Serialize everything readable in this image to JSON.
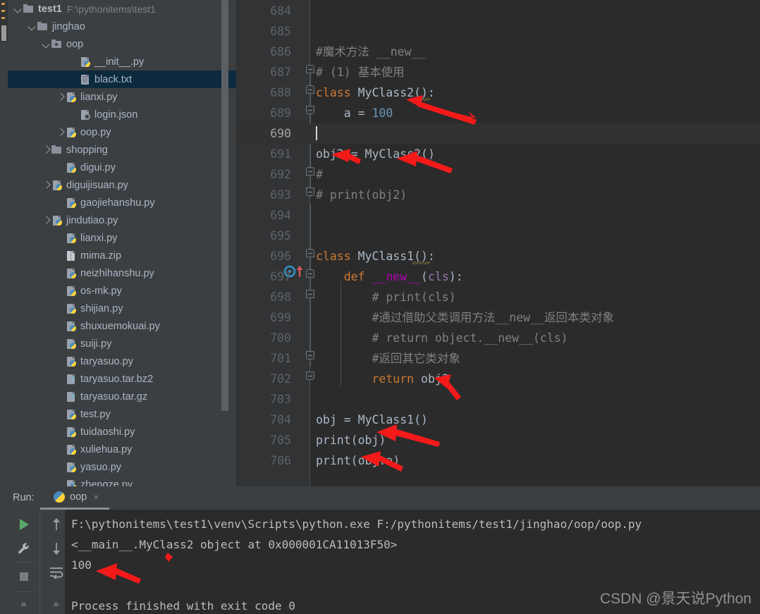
{
  "app": {
    "theme_bg": "#3c3f41",
    "editor_bg": "#2b2b2b",
    "accent": "#4a88c7",
    "selection_bg": "#0d293e",
    "watermark": "CSDN @景天说Python"
  },
  "project_tree": {
    "items": [
      {
        "indent": 0,
        "twisty": "down",
        "icon": "folder-icon",
        "label": "test1",
        "path": "F:\\pythonitems\\test1",
        "bold": true,
        "selected": false
      },
      {
        "indent": 1,
        "twisty": "down",
        "icon": "folder-icon",
        "label": "jinghao",
        "path": "",
        "bold": false,
        "selected": false
      },
      {
        "indent": 2,
        "twisty": "down",
        "icon": "folder-src-icon",
        "label": "oop",
        "path": "",
        "bold": false,
        "selected": false
      },
      {
        "indent": 4,
        "twisty": "none",
        "icon": "python-file-icon",
        "label": "__init__.py",
        "path": "",
        "bold": false,
        "selected": false
      },
      {
        "indent": 4,
        "twisty": "none",
        "icon": "text-file-icon",
        "label": "black.txt",
        "path": "",
        "bold": false,
        "selected": true
      },
      {
        "indent": 3,
        "twisty": "right",
        "icon": "python-file-icon",
        "label": "lianxi.py",
        "path": "",
        "bold": false,
        "selected": false
      },
      {
        "indent": 4,
        "twisty": "none",
        "icon": "json-file-icon",
        "label": "login.json",
        "path": "",
        "bold": false,
        "selected": false
      },
      {
        "indent": 3,
        "twisty": "right",
        "icon": "python-file-icon",
        "label": "oop.py",
        "path": "",
        "bold": false,
        "selected": false
      },
      {
        "indent": 2,
        "twisty": "right",
        "icon": "folder-icon",
        "label": "shopping",
        "path": "",
        "bold": false,
        "selected": false
      },
      {
        "indent": 3,
        "twisty": "none",
        "icon": "python-file-icon",
        "label": "digui.py",
        "path": "",
        "bold": false,
        "selected": false
      },
      {
        "indent": 2,
        "twisty": "right",
        "icon": "python-file-icon",
        "label": "diguijisuan.py",
        "path": "",
        "bold": false,
        "selected": false
      },
      {
        "indent": 3,
        "twisty": "none",
        "icon": "python-file-icon",
        "label": "gaojiehanshu.py",
        "path": "",
        "bold": false,
        "selected": false
      },
      {
        "indent": 2,
        "twisty": "right",
        "icon": "python-file-icon",
        "label": "jindutiao.py",
        "path": "",
        "bold": false,
        "selected": false
      },
      {
        "indent": 3,
        "twisty": "none",
        "icon": "python-file-icon",
        "label": "lianxi.py",
        "path": "",
        "bold": false,
        "selected": false
      },
      {
        "indent": 3,
        "twisty": "none",
        "icon": "zip-file-icon",
        "label": "mima.zip",
        "path": "",
        "bold": false,
        "selected": false
      },
      {
        "indent": 3,
        "twisty": "none",
        "icon": "python-file-icon",
        "label": "neizhihanshu.py",
        "path": "",
        "bold": false,
        "selected": false
      },
      {
        "indent": 3,
        "twisty": "none",
        "icon": "python-file-icon",
        "label": "os-mk.py",
        "path": "",
        "bold": false,
        "selected": false
      },
      {
        "indent": 3,
        "twisty": "none",
        "icon": "python-file-icon",
        "label": "shijian.py",
        "path": "",
        "bold": false,
        "selected": false
      },
      {
        "indent": 3,
        "twisty": "none",
        "icon": "python-file-icon",
        "label": "shuxuemokuai.py",
        "path": "",
        "bold": false,
        "selected": false
      },
      {
        "indent": 3,
        "twisty": "none",
        "icon": "python-file-icon",
        "label": "suiji.py",
        "path": "",
        "bold": false,
        "selected": false
      },
      {
        "indent": 3,
        "twisty": "none",
        "icon": "python-file-icon",
        "label": "taryasuo.py",
        "path": "",
        "bold": false,
        "selected": false
      },
      {
        "indent": 3,
        "twisty": "none",
        "icon": "unknown-file-icon",
        "label": "taryasuo.tar.bz2",
        "path": "",
        "bold": false,
        "selected": false
      },
      {
        "indent": 3,
        "twisty": "none",
        "icon": "unknown-file-icon",
        "label": "taryasuo.tar.gz",
        "path": "",
        "bold": false,
        "selected": false
      },
      {
        "indent": 3,
        "twisty": "none",
        "icon": "python-file-icon",
        "label": "test.py",
        "path": "",
        "bold": false,
        "selected": false
      },
      {
        "indent": 3,
        "twisty": "none",
        "icon": "python-file-icon",
        "label": "tuidaoshi.py",
        "path": "",
        "bold": false,
        "selected": false
      },
      {
        "indent": 3,
        "twisty": "none",
        "icon": "python-file-icon",
        "label": "xuliehua.py",
        "path": "",
        "bold": false,
        "selected": false
      },
      {
        "indent": 3,
        "twisty": "none",
        "icon": "python-file-icon",
        "label": "yasuo.py",
        "path": "",
        "bold": false,
        "selected": false
      },
      {
        "indent": 3,
        "twisty": "none",
        "icon": "python-file-icon",
        "label": "zhengze.py",
        "path": "",
        "bold": false,
        "selected": false
      }
    ]
  },
  "editor": {
    "first_line_number": 684,
    "current_line_number": 690,
    "lines": [
      {
        "n": 684,
        "tokens": []
      },
      {
        "n": 685,
        "tokens": []
      },
      {
        "n": 686,
        "tokens": [
          {
            "t": "#魔术方法 __new__",
            "c": "cmt"
          }
        ]
      },
      {
        "n": 687,
        "tokens": [
          {
            "t": "# (1) 基本使用",
            "c": "cmt"
          }
        ]
      },
      {
        "n": 688,
        "tokens": [
          {
            "t": "class ",
            "c": "kw"
          },
          {
            "t": "MyClass2",
            "c": "cls"
          },
          {
            "t": "():",
            "c": "var"
          }
        ]
      },
      {
        "n": 689,
        "tokens": [
          {
            "t": "    a = ",
            "c": "var"
          },
          {
            "t": "100",
            "c": "num"
          }
        ]
      },
      {
        "n": 690,
        "tokens": []
      },
      {
        "n": 691,
        "tokens": [
          {
            "t": "obj2 = ",
            "c": "var"
          },
          {
            "t": "MyClass2",
            "c": "cls"
          },
          {
            "t": "()",
            "c": "var"
          }
        ]
      },
      {
        "n": 692,
        "tokens": [
          {
            "t": "#",
            "c": "cmt"
          }
        ]
      },
      {
        "n": 693,
        "tokens": [
          {
            "t": "# print(obj2)",
            "c": "cmt"
          }
        ]
      },
      {
        "n": 694,
        "tokens": []
      },
      {
        "n": 695,
        "tokens": []
      },
      {
        "n": 696,
        "tokens": [
          {
            "t": "class ",
            "c": "kw"
          },
          {
            "t": "MyClass1",
            "c": "cls"
          },
          {
            "t": "():",
            "c": "var"
          }
        ]
      },
      {
        "n": 697,
        "tokens": [
          {
            "t": "    ",
            "c": "var"
          },
          {
            "t": "def ",
            "c": "kw"
          },
          {
            "t": "__new__",
            "c": "magic"
          },
          {
            "t": "(",
            "c": "var"
          },
          {
            "t": "cls",
            "c": "param"
          },
          {
            "t": "):",
            "c": "var"
          }
        ]
      },
      {
        "n": 698,
        "tokens": [
          {
            "t": "        # print(cls)",
            "c": "cmt"
          }
        ]
      },
      {
        "n": 699,
        "tokens": [
          {
            "t": "        #通过借助父类调用方法__new__返回本类对象",
            "c": "cmt"
          }
        ]
      },
      {
        "n": 700,
        "tokens": [
          {
            "t": "        # return object.__new__(cls)",
            "c": "cmt"
          }
        ]
      },
      {
        "n": 701,
        "tokens": [
          {
            "t": "        #返回其它类对象",
            "c": "cmt"
          }
        ]
      },
      {
        "n": 702,
        "tokens": [
          {
            "t": "        ",
            "c": "var"
          },
          {
            "t": "return ",
            "c": "kw"
          },
          {
            "t": "obj2",
            "c": "var"
          }
        ]
      },
      {
        "n": 703,
        "tokens": []
      },
      {
        "n": 704,
        "tokens": [
          {
            "t": "obj = ",
            "c": "var"
          },
          {
            "t": "MyClass1",
            "c": "cls"
          },
          {
            "t": "()",
            "c": "var"
          }
        ]
      },
      {
        "n": 705,
        "tokens": [
          {
            "t": "print",
            "c": "fn"
          },
          {
            "t": "(obj)",
            "c": "var"
          }
        ]
      },
      {
        "n": 706,
        "tokens": [
          {
            "t": "print",
            "c": "fn"
          },
          {
            "t": "(obj.a)",
            "c": "var"
          }
        ]
      }
    ]
  },
  "run_panel": {
    "label": "Run:",
    "tab_name": "oop",
    "tab_close": "×",
    "toolbar": {
      "rerun": "run-icon",
      "settings": "wrench-icon",
      "stop": "stop-icon",
      "expand_left": "»",
      "up": "up-arrow-icon",
      "down": "down-arrow-icon",
      "soft_wrap": "soft-wrap-icon",
      "expand_right": "»"
    },
    "console_lines": [
      "F:\\pythonitems\\test1\\venv\\Scripts\\python.exe F:/pythonitems/test1/jinghao/oop/oop.py",
      "<__main__.MyClass2 object at 0x000001CA11013F50>",
      "100",
      "",
      "Process finished with exit code 0"
    ]
  },
  "annotations": {
    "arrow_color": "#f41a1a",
    "arrows": [
      {
        "name": "arrow-to-myclass2-def"
      },
      {
        "name": "arrow-to-obj2-left"
      },
      {
        "name": "arrow-to-myclass2-call"
      },
      {
        "name": "arrow-to-return-obj2"
      },
      {
        "name": "arrow-to-print-obj"
      },
      {
        "name": "arrow-to-print-obj-a"
      },
      {
        "name": "arrow-to-console-100"
      },
      {
        "name": "arrow-mark-console-object"
      }
    ]
  }
}
